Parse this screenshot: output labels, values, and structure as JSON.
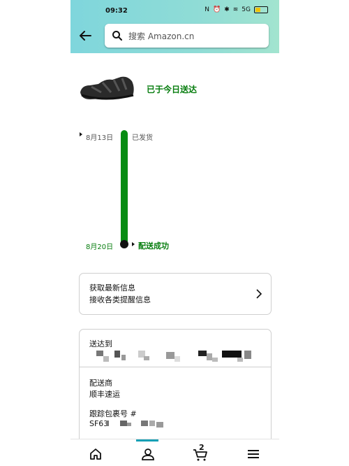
{
  "status_bar": {
    "time": "09:32",
    "network": "5G"
  },
  "search": {
    "placeholder": "搜索 Amazon.cn"
  },
  "shipment": {
    "status": "已于今日送达"
  },
  "timeline": [
    {
      "date": "8月13日",
      "event": "已发货"
    },
    {
      "date": "8月20日",
      "event": "配送成功"
    }
  ],
  "updates_card": {
    "title": "获取最新信息",
    "subtitle": "接收各类提醒信息"
  },
  "delivery_card": {
    "header": "送达到",
    "carrier_label": "配送商",
    "carrier_value": "顺丰速运",
    "tracking_label": "跟踪包裹号 #",
    "tracking_value": "SF63"
  },
  "bottom_nav": {
    "cart_count": "2"
  },
  "colors": {
    "accent_green": "#067d0e",
    "timeline_green": "#078c12",
    "nav_indicator": "#17a0b5"
  },
  "icons": [
    "back-arrow-icon",
    "search-icon",
    "chevron-right-icon",
    "home-icon",
    "account-icon",
    "cart-icon",
    "menu-icon"
  ]
}
